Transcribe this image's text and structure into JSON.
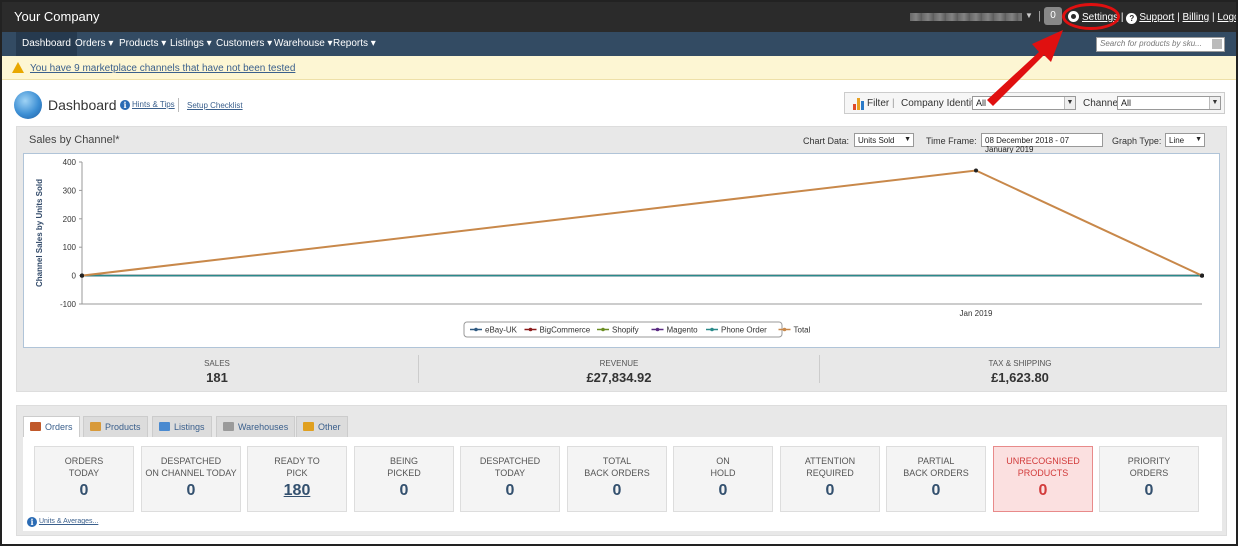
{
  "header": {
    "brand": "Your Company",
    "notification_count": "0",
    "links": {
      "settings": "Settings",
      "support": "Support",
      "billing": "Billing",
      "logout": "Logout"
    },
    "separator": "|"
  },
  "nav": {
    "items": [
      {
        "label": "Dashboard"
      },
      {
        "label": "Orders ▾"
      },
      {
        "label": "Products ▾"
      },
      {
        "label": "Listings ▾"
      },
      {
        "label": "Customers ▾"
      },
      {
        "label": "Warehouse ▾"
      },
      {
        "label": "Reports ▾"
      }
    ],
    "search_placeholder": "Search for products by sku..."
  },
  "warning": {
    "text": "You have 9 marketplace channels that have not been tested"
  },
  "page": {
    "title": "Dashboard",
    "hints": "Hints & Tips",
    "setup": "Setup Checklist"
  },
  "filter": {
    "label": "Filter",
    "sep": "|",
    "company_label": "Company Identity:",
    "company_value": "All",
    "channel_label": "Channel:",
    "channel_value": "All"
  },
  "chart_panel": {
    "title": "Sales by Channel*",
    "chart_data_label": "Chart Data:",
    "chart_data_value": "Units Sold",
    "time_frame_label": "Time Frame:",
    "time_frame_value": "08 December 2018 - 07 January 2019",
    "graph_type_label": "Graph Type:",
    "graph_type_value": "Line"
  },
  "chart_data": {
    "type": "line",
    "ylabel": "Channel Sales by Units Sold",
    "xlabel": "",
    "ylim": [
      -100,
      400
    ],
    "y_ticks": [
      -100,
      0,
      100,
      200,
      300,
      400
    ],
    "x_ticks": [
      "Jan 2019"
    ],
    "series": [
      {
        "name": "eBay-UK",
        "color": "#2f5a82",
        "values": [
          0,
          0,
          0
        ]
      },
      {
        "name": "BigCommerce",
        "color": "#8b1a1a",
        "values": [
          0,
          0,
          0
        ]
      },
      {
        "name": "Shopify",
        "color": "#6b8e23",
        "values": [
          0,
          0,
          0
        ]
      },
      {
        "name": "Magento",
        "color": "#5a2a82",
        "values": [
          0,
          0,
          0
        ]
      },
      {
        "name": "Phone Order",
        "color": "#2a8a8a",
        "values": [
          0,
          0,
          0
        ]
      },
      {
        "name": "Total",
        "color": "#c8884a",
        "values": [
          0,
          370,
          0
        ]
      }
    ]
  },
  "stats": [
    {
      "label": "SALES",
      "value": "181"
    },
    {
      "label": "REVENUE",
      "value": "£27,834.92"
    },
    {
      "label": "TAX & SHIPPING",
      "value": "£1,623.80"
    }
  ],
  "tabs": [
    {
      "label": "Orders",
      "color": "#c0582a"
    },
    {
      "label": "Products",
      "color": "#d89a3a"
    },
    {
      "label": "Listings",
      "color": "#4a8ad0"
    },
    {
      "label": "Warehouses",
      "color": "#9a9a9a"
    },
    {
      "label": "Other",
      "color": "#e0a020"
    }
  ],
  "cards": [
    {
      "line1": "ORDERS",
      "line2": "TODAY",
      "value": "0"
    },
    {
      "line1": "DESPATCHED",
      "line2": "ON CHANNEL TODAY",
      "value": "0"
    },
    {
      "line1": "READY TO",
      "line2": "PICK",
      "value": "180"
    },
    {
      "line1": "BEING",
      "line2": "PICKED",
      "value": "0"
    },
    {
      "line1": "DESPATCHED",
      "line2": "TODAY",
      "value": "0"
    },
    {
      "line1": "TOTAL",
      "line2": "BACK ORDERS",
      "value": "0"
    },
    {
      "line1": "ON",
      "line2": "HOLD",
      "value": "0"
    },
    {
      "line1": "ATTENTION",
      "line2": "REQUIRED",
      "value": "0"
    },
    {
      "line1": "PARTIAL",
      "line2": "BACK ORDERS",
      "value": "0"
    },
    {
      "line1": "UNRECOGNISED",
      "line2": "PRODUCTS",
      "value": "0"
    },
    {
      "line1": "PRIORITY",
      "line2": "ORDERS",
      "value": "0"
    }
  ],
  "units_link": "Units & Averages..."
}
